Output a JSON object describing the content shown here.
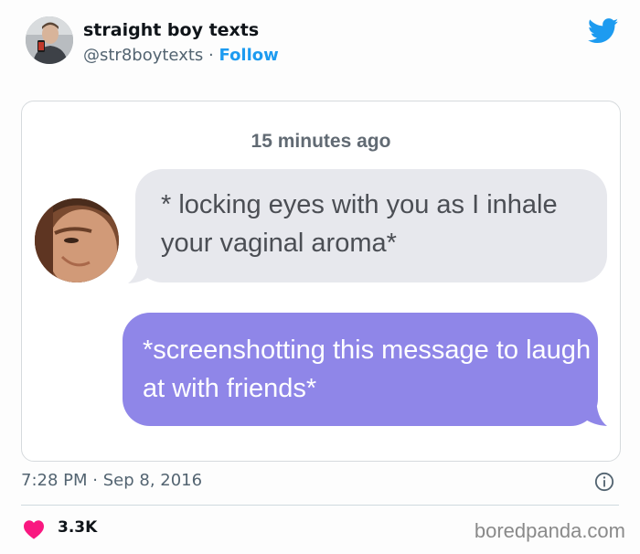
{
  "tweet": {
    "display_name": "straight boy texts",
    "handle": "@str8boytexts",
    "separator": "·",
    "follow_label": "Follow",
    "brand_color": "#1d9bf0",
    "icon": "twitter-bird-icon"
  },
  "conversation": {
    "timestamp": "15 minutes ago",
    "incoming_message": "* locking eyes with you as I inhale your vaginal aroma*",
    "outgoing_message": "*screenshotting this message to laugh at with friends*",
    "incoming_color": "#e7e8ed",
    "outgoing_color": "#8f86e8"
  },
  "footer": {
    "time": "7:28 PM",
    "separator": "·",
    "date": "Sep 8, 2016",
    "likes": "3.3K",
    "heart_color": "#f91880",
    "watermark": "boredpanda.com"
  }
}
